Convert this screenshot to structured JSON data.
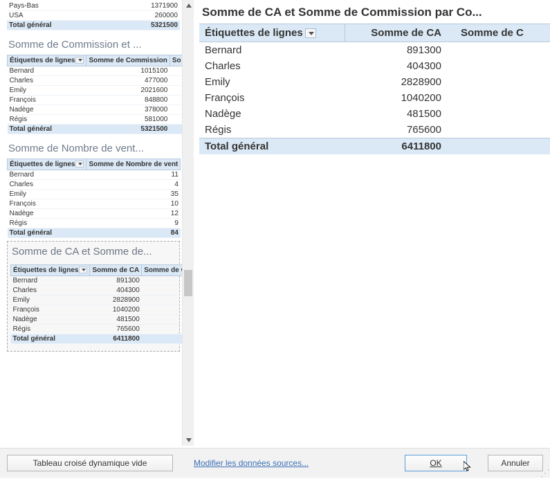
{
  "left": {
    "thumb1": {
      "rows": [
        {
          "label": "Pays-Bas",
          "v": "1371900"
        },
        {
          "label": "USA",
          "v": "260000"
        }
      ],
      "total_label": "Total général",
      "total_v": "5321500"
    },
    "thumb2": {
      "title": "Somme de Commission et ...",
      "h1": "Étiquettes de lignes",
      "h2": "Somme de Commission",
      "h3": "So",
      "rows": [
        {
          "label": "Bernard",
          "v": "1015100"
        },
        {
          "label": "Charles",
          "v": "477000"
        },
        {
          "label": "Emily",
          "v": "2021600"
        },
        {
          "label": "François",
          "v": "848800"
        },
        {
          "label": "Nadège",
          "v": "378000"
        },
        {
          "label": "Régis",
          "v": "581000"
        }
      ],
      "total_label": "Total général",
      "total_v": "5321500"
    },
    "thumb3": {
      "title": "Somme de Nombre de vent...",
      "h1": "Étiquettes de lignes",
      "h2": "Somme de Nombre de vent",
      "rows": [
        {
          "label": "Bernard",
          "v": "11"
        },
        {
          "label": "Charles",
          "v": "4"
        },
        {
          "label": "Emily",
          "v": "35"
        },
        {
          "label": "François",
          "v": "10"
        },
        {
          "label": "Nadège",
          "v": "12"
        },
        {
          "label": "Régis",
          "v": "9"
        }
      ],
      "total_label": "Total général",
      "total_v": "84"
    },
    "thumb4": {
      "title": "Somme de CA et Somme de...",
      "h1": "Étiquettes de lignes",
      "h2": "Somme de CA",
      "h3": "Somme de C",
      "rows": [
        {
          "label": "Bernard",
          "v": "891300"
        },
        {
          "label": "Charles",
          "v": "404300"
        },
        {
          "label": "Emily",
          "v": "2828900"
        },
        {
          "label": "François",
          "v": "1040200"
        },
        {
          "label": "Nadège",
          "v": "481500"
        },
        {
          "label": "Régis",
          "v": "765600"
        }
      ],
      "total_label": "Total général",
      "total_v": "6411800"
    }
  },
  "right": {
    "title": "Somme de CA et Somme de Commission par Co...",
    "h1": "Étiquettes de lignes",
    "h2": "Somme de CA",
    "h3": "Somme de C",
    "rows": [
      {
        "label": "Bernard",
        "v": "891300"
      },
      {
        "label": "Charles",
        "v": "404300"
      },
      {
        "label": "Emily",
        "v": "2828900"
      },
      {
        "label": "François",
        "v": "1040200"
      },
      {
        "label": "Nadège",
        "v": "481500"
      },
      {
        "label": "Régis",
        "v": "765600"
      }
    ],
    "total_label": "Total général",
    "total_v": "6411800"
  },
  "bottom": {
    "empty_pivot": "Tableau croisé dynamique vide",
    "edit_sources": "Modifier les données sources...",
    "ok": "OK",
    "cancel": "Annuler"
  }
}
